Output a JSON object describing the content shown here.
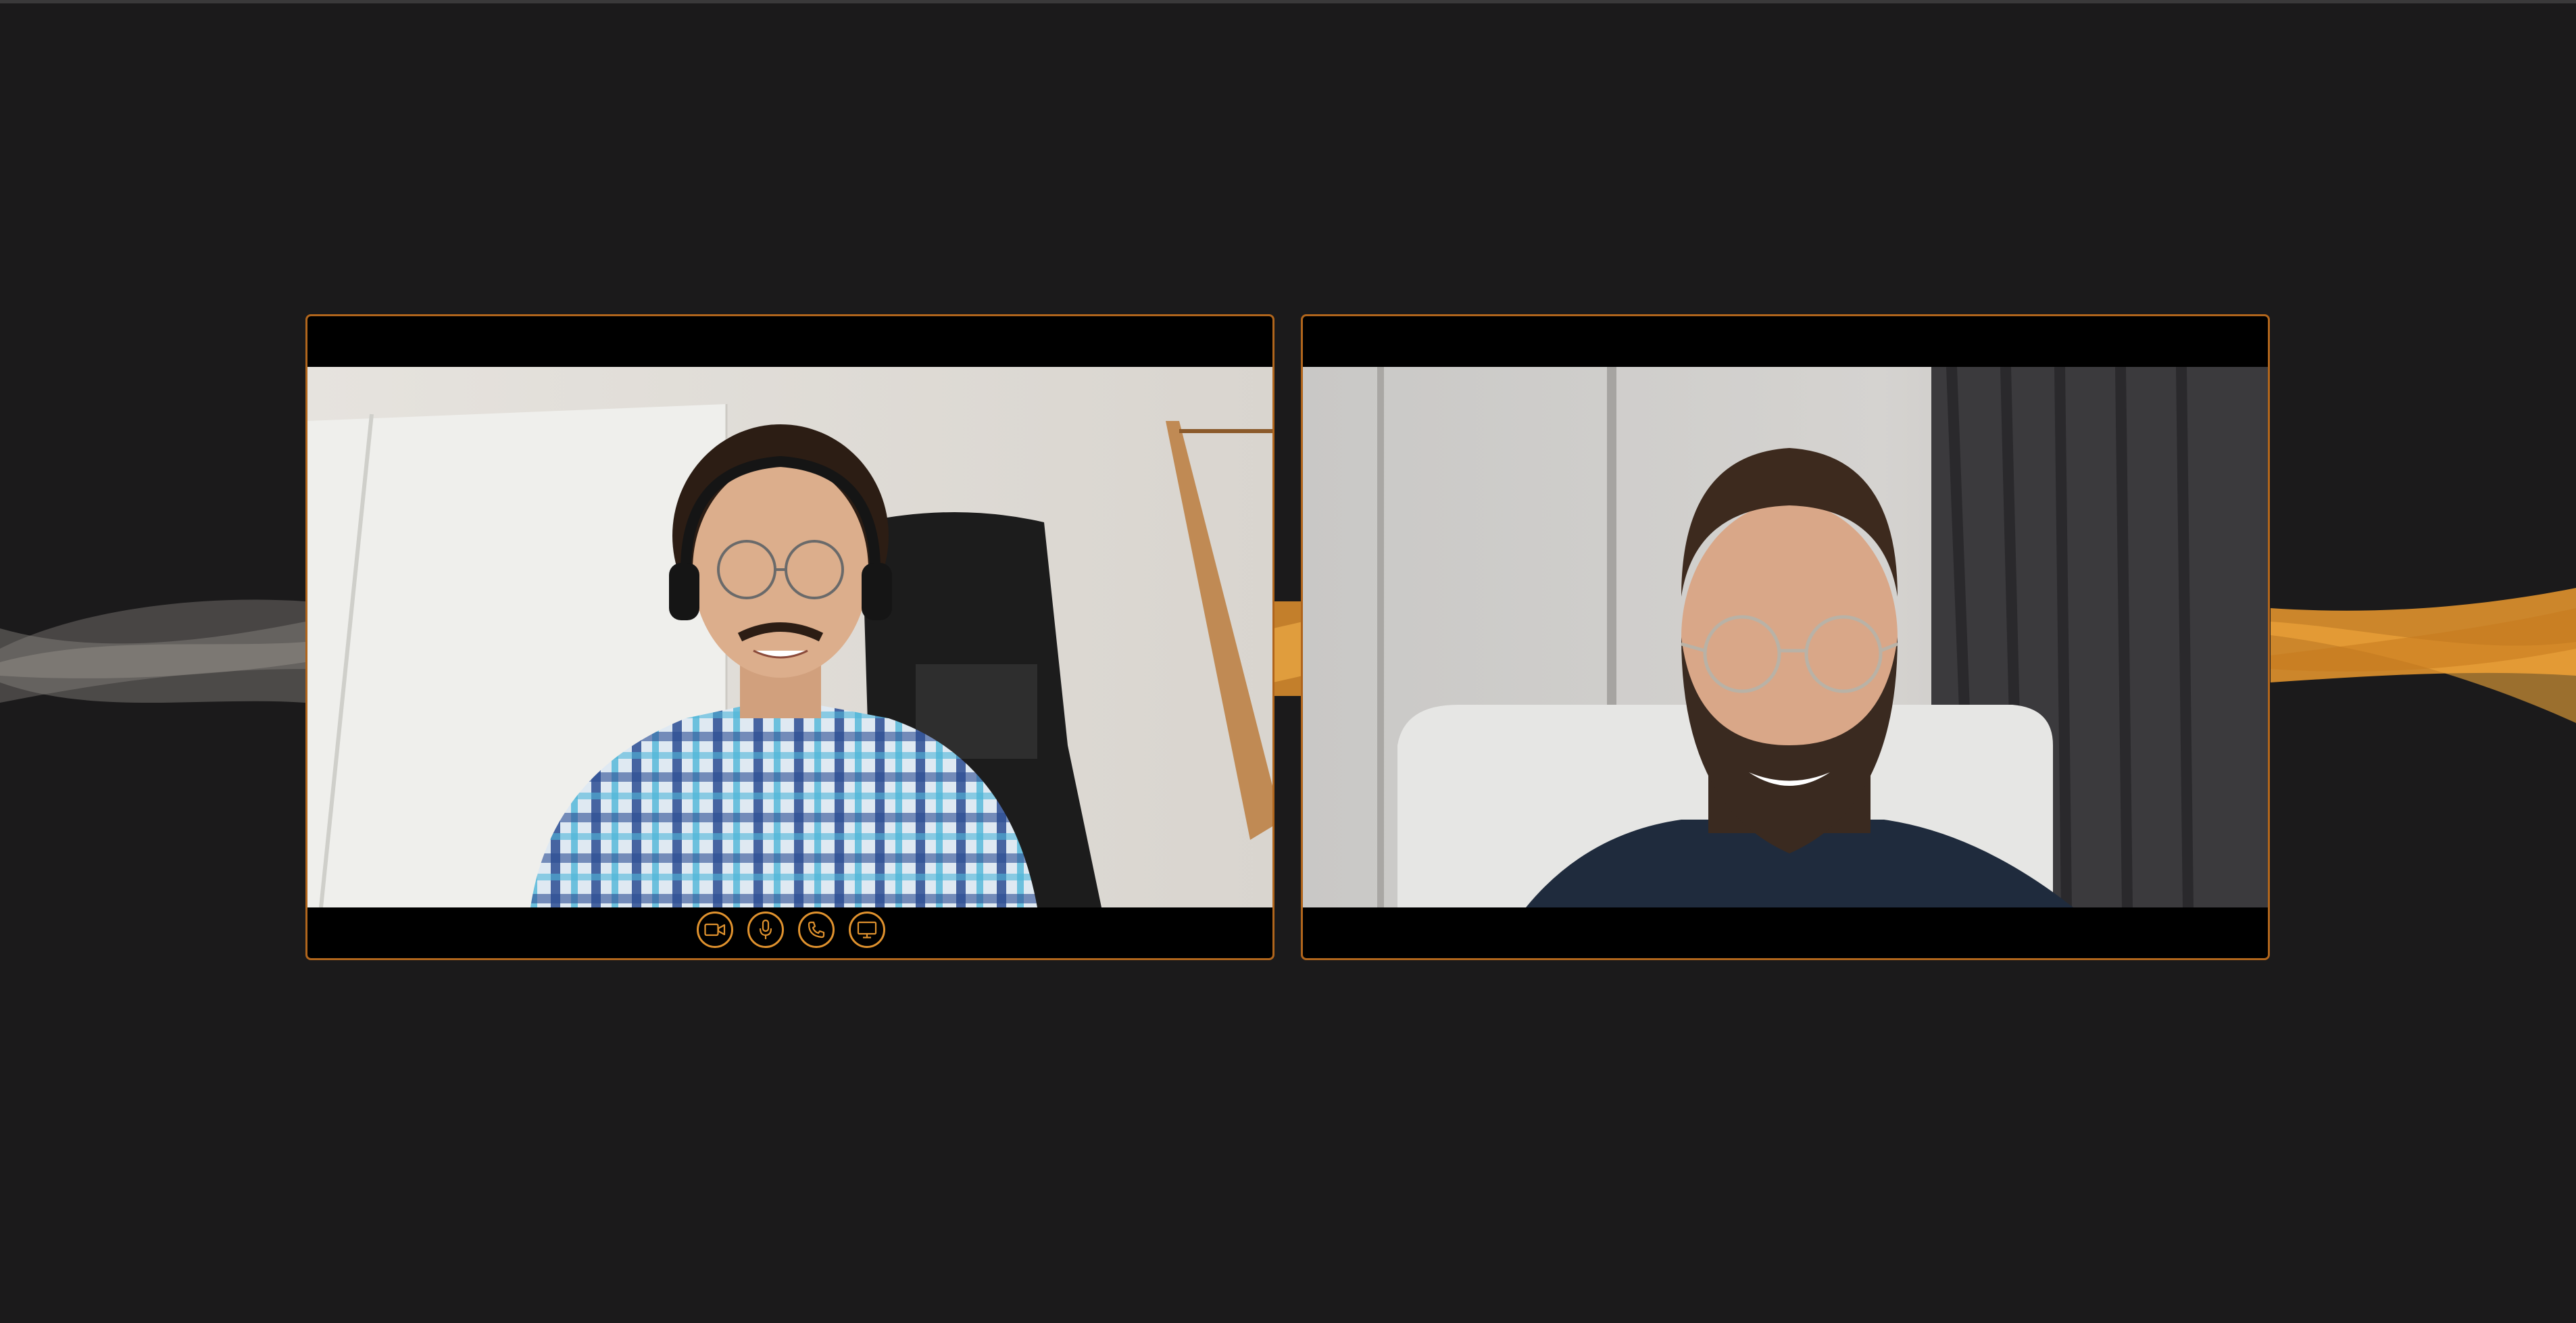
{
  "theme": {
    "background": "#1b1a1b",
    "accent": "#e0922e",
    "tile_border": "#b0651c",
    "tile_fill": "#000000"
  },
  "participants": [
    {
      "position": "left",
      "has_controls": true
    },
    {
      "position": "right",
      "has_controls": false
    }
  ],
  "call_controls": [
    {
      "icon": "video-camera-icon",
      "action": "toggle-video"
    },
    {
      "icon": "microphone-icon",
      "action": "toggle-mic"
    },
    {
      "icon": "phone-icon",
      "action": "end-call"
    },
    {
      "icon": "screen-share-icon",
      "action": "share-screen"
    }
  ]
}
